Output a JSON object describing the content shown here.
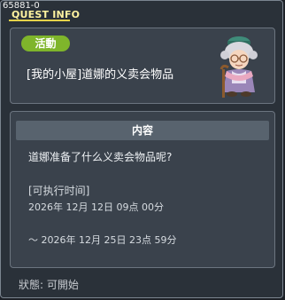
{
  "header": {
    "quest_id": "65881-0",
    "title": "QUEST INFO"
  },
  "quest": {
    "badge": "活動",
    "name": "[我的小屋]道娜的义卖会物品"
  },
  "details": {
    "section_title": "内容",
    "description": "道娜准备了什么义卖会物品呢?",
    "time_label": "[可执行时间]",
    "time_start": "2026年 12月 12日 09点 00分",
    "time_end": "～ 2026年 12月 25日 23点 59分"
  },
  "footer": {
    "status": "狀態: 可開始"
  },
  "colors": {
    "badge": "#7fb52b",
    "title": "#fff3a0",
    "underline": "#e6d24a"
  },
  "icons": {
    "npc": "grandma-npc-portrait"
  }
}
